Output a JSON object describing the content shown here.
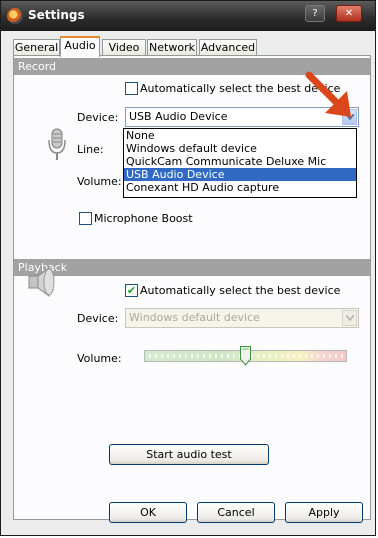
{
  "window": {
    "title": "Settings"
  },
  "tabs": [
    "General",
    "Audio",
    "Video",
    "Network",
    "Advanced"
  ],
  "record": {
    "section_title": "Record",
    "auto_select_label": "Automatically select the best device",
    "auto_select_checked": false,
    "device_label": "Device:",
    "device_value": "USB Audio Device",
    "line_label": "Line:",
    "volume_label": "Volume:",
    "mic_boost_label": "Microphone Boost",
    "mic_boost_checked": false,
    "device_options": [
      "None",
      "Windows default device",
      "QuickCam Communicate Deluxe Mic",
      "USB Audio Device",
      "Conexant HD Audio capture"
    ],
    "selected_option": "USB Audio Device"
  },
  "playback": {
    "section_title": "Playback",
    "auto_select_label": "Automatically select the best device",
    "auto_select_checked": true,
    "device_label": "Device:",
    "device_value": "Windows default device",
    "volume_label": "Volume:",
    "volume_level_fraction": 0.5
  },
  "buttons": {
    "start_test": "Start audio test",
    "ok": "OK",
    "cancel": "Cancel",
    "apply": "Apply"
  },
  "colors": {
    "section_bar": "#a2a2a2",
    "selection": "#316ac5",
    "annotation_arrow": "#d9471b",
    "active_tab_accent": "#e68b2c"
  }
}
